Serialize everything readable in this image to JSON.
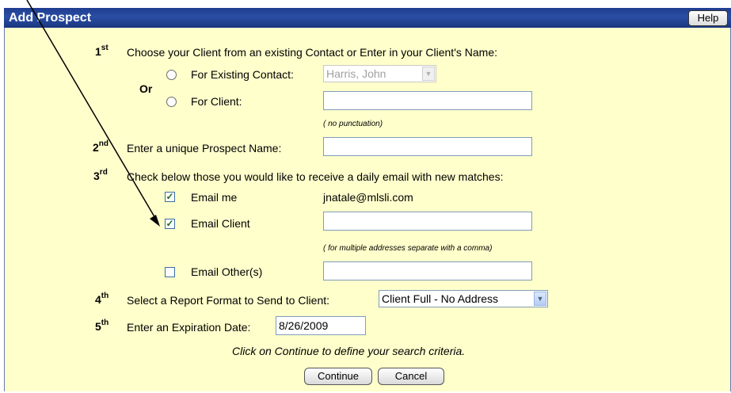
{
  "header": {
    "title": "Add Prospect",
    "help_label": "Help"
  },
  "step1": {
    "ordinal": "1",
    "suffix": "st",
    "text": "Choose your Client from an existing Contact or Enter in your Client's Name:",
    "or_label": "Or",
    "existing_contact_label": "For Existing Contact:",
    "existing_contact_value": "Harris, John",
    "client_label": "For Client:",
    "client_value": "",
    "hint": "( no punctuation)"
  },
  "step2": {
    "ordinal": "2",
    "suffix": "nd",
    "text": "Enter a unique Prospect Name:",
    "value": ""
  },
  "step3": {
    "ordinal": "3",
    "suffix": "rd",
    "text": "Check below those you would like to receive a daily email with new matches:",
    "email_me_label": "Email me",
    "email_me_checked": true,
    "email_me_address": "jnatale@mlsli.com",
    "email_client_label": "Email Client",
    "email_client_checked": true,
    "email_client_value": "",
    "multi_hint": "( for multiple addresses separate with a comma)",
    "email_other_label": "Email Other(s)",
    "email_other_checked": false,
    "email_other_value": ""
  },
  "step4": {
    "ordinal": "4",
    "suffix": "th",
    "text": "Select a Report Format to Send to Client:",
    "report_format": "Client Full - No Address"
  },
  "step5": {
    "ordinal": "5",
    "suffix": "th",
    "text": "Enter an Expiration Date:",
    "date": "8/26/2009"
  },
  "instruction": "Click on Continue to define your search criteria.",
  "buttons": {
    "continue": "Continue",
    "cancel": "Cancel"
  },
  "check_glyph": "✓"
}
